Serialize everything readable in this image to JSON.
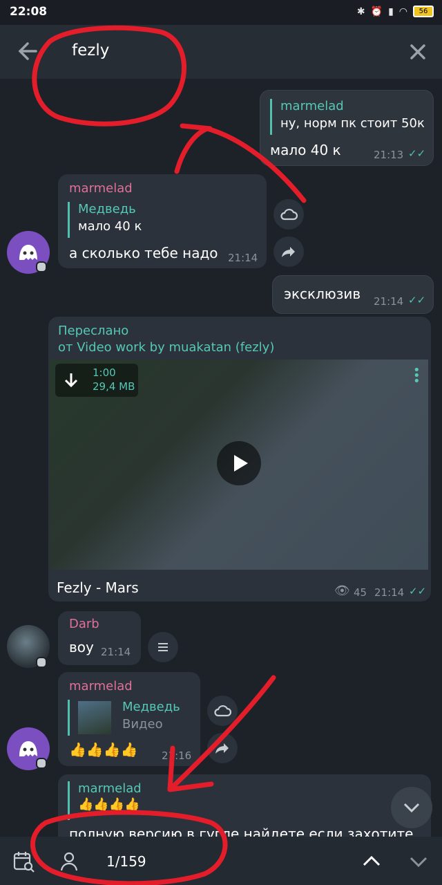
{
  "status": {
    "time": "22:08",
    "battery": "56"
  },
  "search": {
    "query": "fezly"
  },
  "messages": {
    "m1": {
      "reply_author": "marmelad",
      "reply_text": "ну, норм пк стоит 50к",
      "text": "мало 40 к",
      "time": "21:13"
    },
    "m2": {
      "author": "marmelad",
      "reply_author": "Медведь",
      "reply_text": "мало 40 к",
      "text": "а сколько тебе надо",
      "time": "21:14"
    },
    "m3": {
      "text": "эксклюзив",
      "time": "21:14"
    },
    "m4": {
      "forward_label": "Переслано",
      "forward_from": "от Video work by muakatan (fezly)",
      "video_duration": "1:00",
      "video_size": "29,4 MB",
      "caption": "Fezly - Mars",
      "views": "45",
      "time": "21:14"
    },
    "m5": {
      "author": "Darb",
      "text": "воу",
      "time": "21:14"
    },
    "m6": {
      "author": "marmelad",
      "reply_author": "Медведь",
      "reply_text": "Видео",
      "text": "👍👍👍👍",
      "time": "21:16"
    },
    "m7": {
      "reply_author": "marmelad",
      "reply_text": "👍👍👍👍",
      "text": "полную версию в гугле найдете если захотите"
    }
  },
  "bottom": {
    "counter": "1/159"
  },
  "colors": {
    "accent": "#56c8b6",
    "author_pink": "#e0709a",
    "background": "#1d2229"
  }
}
